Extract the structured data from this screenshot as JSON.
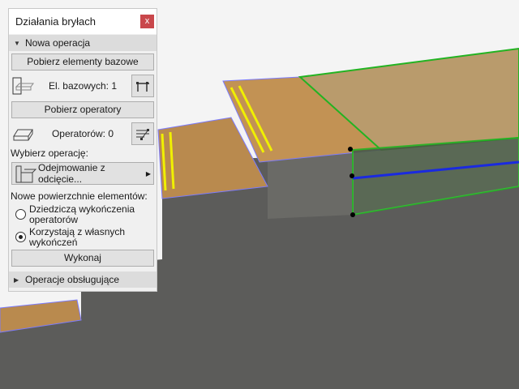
{
  "panel": {
    "title": "Działania bryłach",
    "close_label": "x",
    "section_new": "Nowa operacja",
    "get_base_label": "Pobierz elementy bazowe",
    "base_count_label": "El. bazowych: 1",
    "get_operators_label": "Pobierz operatory",
    "operators_count_label": "Operatorów: 0",
    "choose_op_label": "Wybierz operację:",
    "operation_value": "Odejmowanie z odcięcie...",
    "new_surfaces_label": "Nowe powierzchnie elementów:",
    "radio_options": [
      {
        "label": "Dziedziczą wykończenia operatorów",
        "selected": false
      },
      {
        "label": "Korzystają z własnych wykończeń",
        "selected": true
      }
    ],
    "execute_label": "Wykonaj",
    "section_support": "Operacje obsługujące"
  },
  "colors": {
    "close": "#c9474b",
    "wood": "#b98a4e",
    "green": "#22b322",
    "concrete": "#5a5a58",
    "highlight": "#7b7bff",
    "yellow": "#f0f000"
  }
}
